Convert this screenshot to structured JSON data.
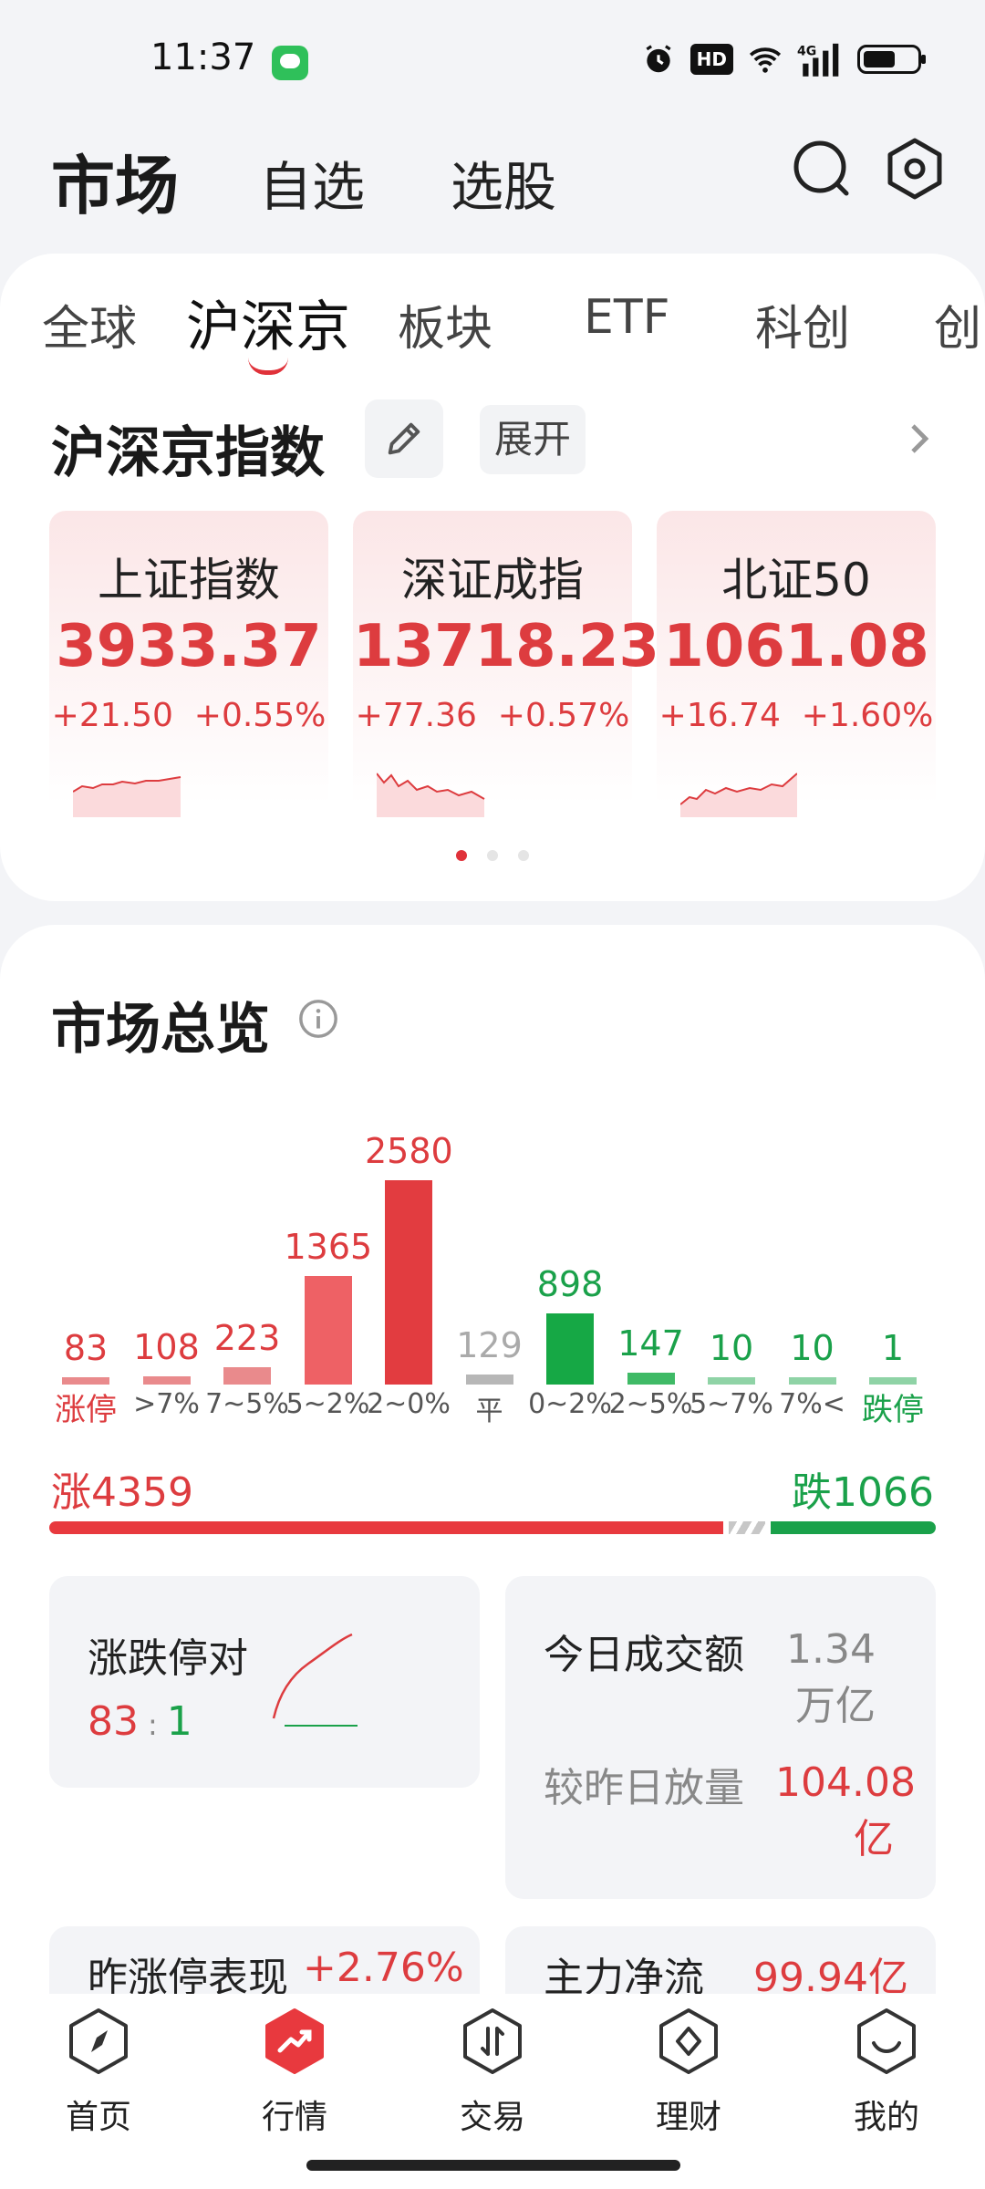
{
  "status_bar": {
    "time": "11:37",
    "hd": "HD",
    "network": "4G"
  },
  "header": {
    "title": "市场",
    "tabs": [
      "自选",
      "选股"
    ]
  },
  "subtabs": [
    "全球",
    "沪深京",
    "板块",
    "ETF",
    "科创",
    "创"
  ],
  "indices_section": {
    "title": "沪深京指数",
    "expand_label": "展开",
    "cards": [
      {
        "name": "上证指数",
        "value": "3933.37",
        "change": "+21.50",
        "pct": "+0.55%"
      },
      {
        "name": "深证成指",
        "value": "13718.23",
        "change": "+77.36",
        "pct": "+0.57%"
      },
      {
        "name": "北证50",
        "value": "1061.08",
        "change": "+16.74",
        "pct": "+1.60%"
      }
    ],
    "page_count": 3,
    "page_active": 0
  },
  "overview": {
    "title": "市场总览",
    "distribution": [
      {
        "label": "涨停",
        "count": 83,
        "color": "#e98a8c"
      },
      {
        "label": ">7%",
        "count": 108,
        "color": "#e98a8c"
      },
      {
        "label": "7~5%",
        "count": 223,
        "color": "#e98a8c"
      },
      {
        "label": "5~2%",
        "count": 1365,
        "color": "#ee6165"
      },
      {
        "label": "2~0%",
        "count": 2580,
        "color": "#e23c40"
      },
      {
        "label": "平",
        "count": 129,
        "color": "#b7b7b7"
      },
      {
        "label": "0~2%",
        "count": 898,
        "color": "#16a845"
      },
      {
        "label": "2~5%",
        "count": 147,
        "color": "#3fba66"
      },
      {
        "label": "5~7%",
        "count": 10,
        "color": "#8fd3a6"
      },
      {
        "label": "7%<",
        "count": 10,
        "color": "#8fd3a6"
      },
      {
        "label": "跌停",
        "count": 1,
        "color": "#8fd3a6"
      }
    ],
    "rise_total": "涨4359",
    "fall_total": "跌1066",
    "rise_count": 4359,
    "fall_count": 1066,
    "limit_ratio": {
      "title": "涨跌停对",
      "up": "83",
      "sep": ":",
      "down": "1"
    },
    "turnover": {
      "title": "今日成交额",
      "value": "1.34万亿",
      "compare_label": "较昨日放量",
      "compare_value": "104.08亿"
    },
    "yesterday_limit": {
      "title": "昨涨停表现",
      "value": "+2.76%"
    },
    "main_flow": {
      "title": "主力净流",
      "value": "99.94亿"
    }
  },
  "bottom_nav": [
    {
      "label": "首页"
    },
    {
      "label": "行情"
    },
    {
      "label": "交易"
    },
    {
      "label": "理财"
    },
    {
      "label": "我的"
    }
  ],
  "colors": {
    "up": "#dd3c3f",
    "down": "#1aa14a",
    "accent": "#e0323a"
  }
}
